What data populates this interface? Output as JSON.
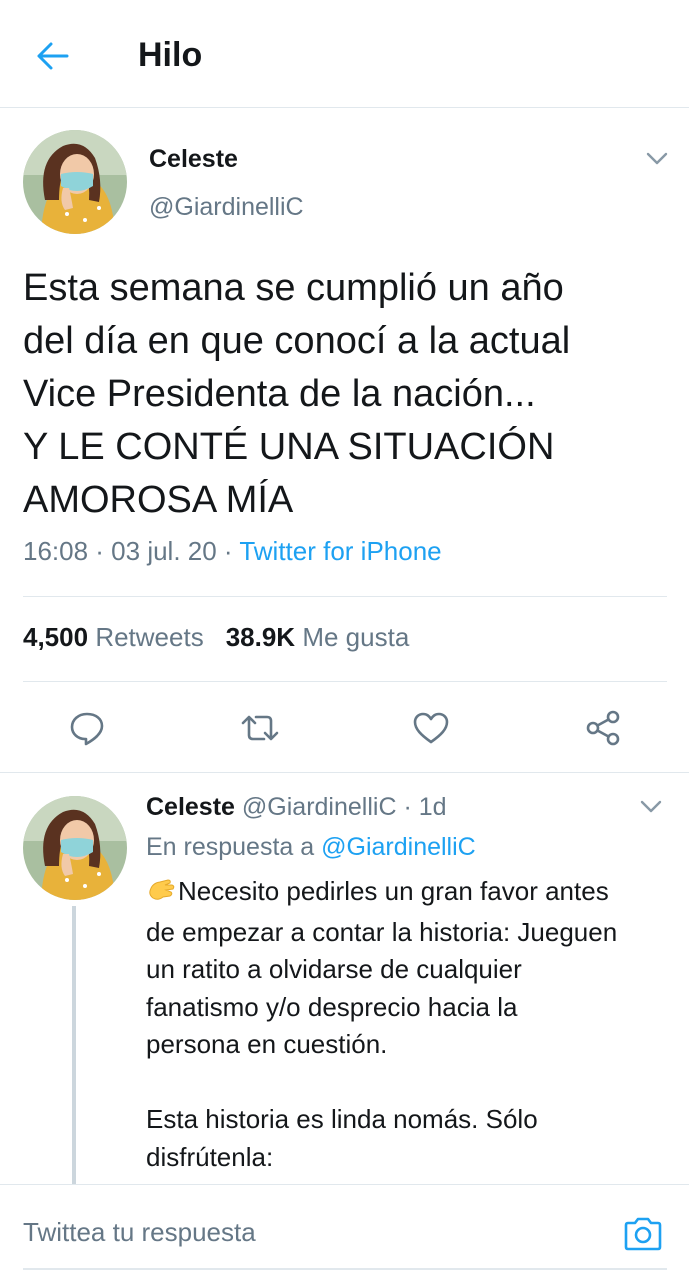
{
  "header": {
    "title": "Hilo"
  },
  "main_tweet": {
    "name": "Celeste",
    "handle": "@GiardinelliC",
    "text": "Esta semana se cumplió un año\ndel día en que conocí a la actual\nVice Presidenta de la nación...\nY LE CONTÉ UNA SITUACIÓN\nAMOROSA MÍA",
    "timestamp": "16:08 · 03 jul. 20 · ",
    "source": "Twitter for iPhone",
    "retweet_count": "4,500",
    "retweet_label": "Retweets",
    "like_count": "38.9K",
    "like_label": "Me gusta",
    "actions": [
      "reply-icon",
      "retweet-icon",
      "like-icon",
      "share-icon"
    ]
  },
  "reply_tweet": {
    "name": "Celeste",
    "handle_time": "@GiardinelliC · 1d",
    "reply_prefix": "En respuesta a ",
    "reply_mention": "@GiardinelliC",
    "text": "Necesito pedirles un gran favor antes\nde empezar a contar la historia: Jueguen\nun ratito a olvidarse de cualquier\nfanatismo y/o desprecio hacia la\npersona en cuestión.\n\nEsta historia es linda nomás. Sólo\ndisfrútenla:",
    "emoji": "clapping-hands-icon"
  },
  "composer": {
    "placeholder": "Twittea tu respuesta"
  },
  "colors": {
    "accent": "#1da1f2",
    "muted": "#657786",
    "text": "#14171a",
    "border": "#e1e8ed"
  }
}
